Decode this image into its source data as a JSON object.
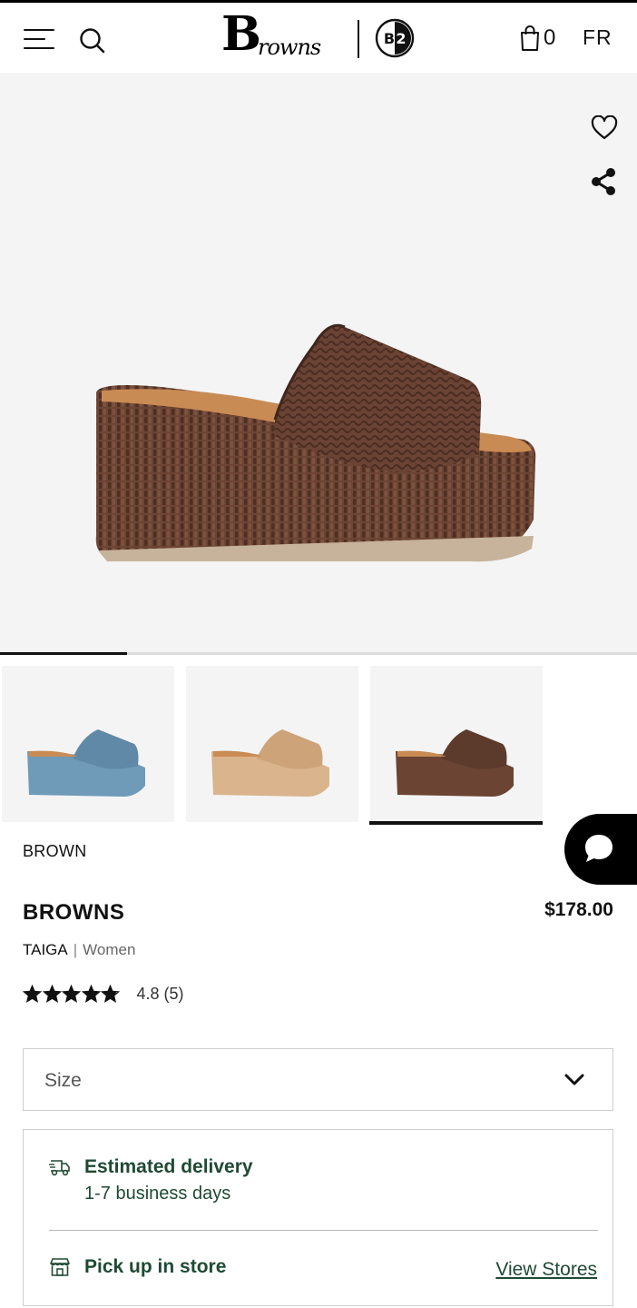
{
  "header": {
    "cart_count": "0",
    "language": "FR",
    "logo_big": "B",
    "logo_script": "rowns",
    "badge_text": "B2"
  },
  "gallery": {
    "progress_fraction": 0.2,
    "thumbnails": [
      {
        "color": "#6f9ab8"
      },
      {
        "color": "#d9b48c"
      },
      {
        "color": "#6b4433"
      }
    ],
    "active_thumbnail": 2
  },
  "product": {
    "color_name": "BROWN",
    "brand": "BROWNS",
    "price": "$178.00",
    "model": "TAIGA",
    "separator": "|",
    "gender": "Women",
    "rating_value": 4.8,
    "rating_text": "4.8 (5)"
  },
  "size": {
    "label": "Size"
  },
  "delivery": {
    "title": "Estimated delivery",
    "subtitle": "1-7 business days",
    "pickup_title": "Pick up in store",
    "view_stores": "View Stores"
  },
  "colors": {
    "accent_green": "#1f4a33",
    "hero_background": "#f4f4f4",
    "shoe_brown": "#6b4433"
  },
  "icons": [
    "menu-icon",
    "search-icon",
    "cart-icon",
    "heart-icon",
    "share-icon",
    "chat-icon",
    "star-icon",
    "chevron-down-icon",
    "truck-icon",
    "store-icon"
  ]
}
